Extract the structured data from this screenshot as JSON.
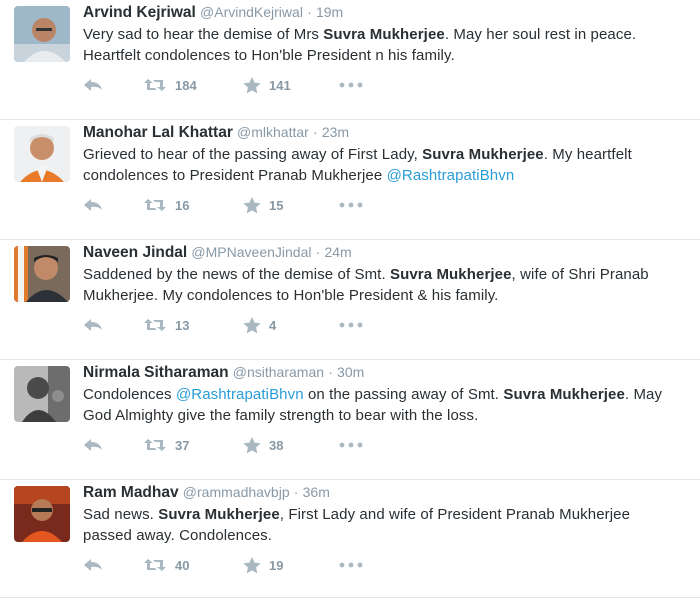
{
  "colors": {
    "name": "#292f33",
    "meta": "#8899a6",
    "mention": "#2a9cd8",
    "divider": "#e1e8ed"
  },
  "icons": {
    "reply": "reply-arrow-icon",
    "retweet": "retweet-icon",
    "favorite": "star-icon",
    "more": "ellipsis-icon"
  },
  "tweets": [
    {
      "fullname": "Arvind Kejriwal",
      "handle": "@ArvindKejriwal",
      "separator": "·",
      "time": "19m",
      "text": [
        {
          "t": "Very sad to hear the demise of Mrs "
        },
        {
          "t": "Suvra Mukherjee",
          "b": true
        },
        {
          "t": ". May her soul rest in peace. Heartfelt condolences to Hon'ble President n his family."
        }
      ],
      "retweets": "184",
      "favorites": "141"
    },
    {
      "fullname": "Manohar Lal Khattar",
      "handle": "@mlkhattar",
      "separator": "·",
      "time": "23m",
      "text": [
        {
          "t": "Grieved to hear of the passing away of First Lady, "
        },
        {
          "t": "Suvra Mukherjee",
          "b": true
        },
        {
          "t": ". My heartfelt condolences to President Pranab Mukherjee "
        },
        {
          "t": "@RashtrapatiBhvn",
          "m": true
        }
      ],
      "retweets": "16",
      "favorites": "15"
    },
    {
      "fullname": "Naveen Jindal",
      "handle": "@MPNaveenJindal",
      "separator": "·",
      "time": "24m",
      "text": [
        {
          "t": "Saddened by the news of the demise of Smt. "
        },
        {
          "t": "Suvra Mukherjee",
          "b": true
        },
        {
          "t": ", wife of Shri Pranab Mukherjee. My condolences to Hon'ble President & his family."
        }
      ],
      "retweets": "13",
      "favorites": "4"
    },
    {
      "fullname": "Nirmala Sitharaman",
      "handle": "@nsitharaman",
      "separator": "·",
      "time": "30m",
      "text": [
        {
          "t": "Condolences "
        },
        {
          "t": "@RashtrapatiBhvn",
          "m": true
        },
        {
          "t": " on the passing away of Smt. "
        },
        {
          "t": "Suvra Mukherjee",
          "b": true
        },
        {
          "t": ". May God Almighty give the family strength to bear with the loss."
        }
      ],
      "retweets": "37",
      "favorites": "38"
    },
    {
      "fullname": "Ram Madhav",
      "handle": "@rammadhavbjp",
      "separator": "·",
      "time": "36m",
      "text": [
        {
          "t": "Sad news. "
        },
        {
          "t": "Suvra Mukherjee",
          "b": true
        },
        {
          "t": ", First Lady and wife of President Pranab Mukherjee passed away. Condolences."
        }
      ],
      "retweets": "40",
      "favorites": "19"
    }
  ]
}
